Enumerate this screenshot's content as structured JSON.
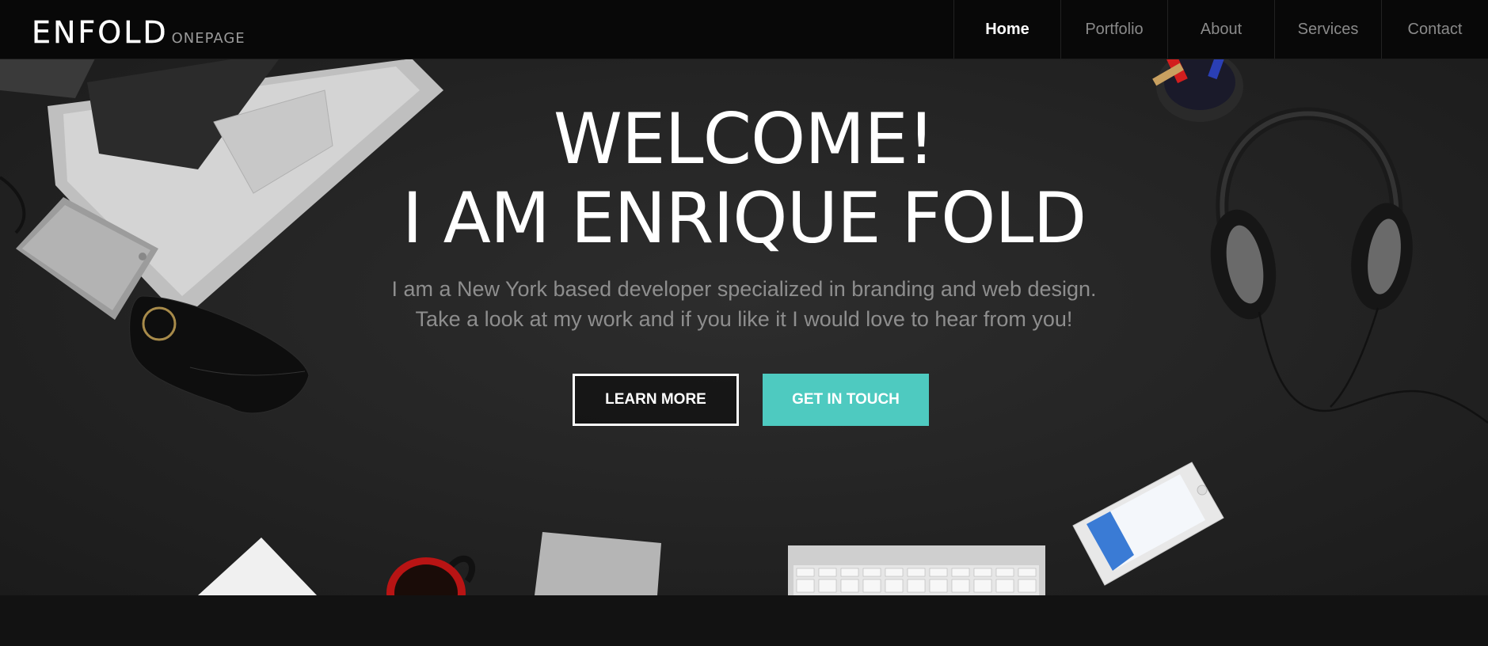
{
  "header": {
    "logo_main": "ENFOLD",
    "logo_sub": "ONEPAGE",
    "nav": [
      {
        "label": "Home",
        "active": true
      },
      {
        "label": "Portfolio",
        "active": false
      },
      {
        "label": "About",
        "active": false
      },
      {
        "label": "Services",
        "active": false
      },
      {
        "label": "Contact",
        "active": false
      }
    ]
  },
  "hero": {
    "title_line1": "WELCOME!",
    "title_line2": "I AM ENRIQUE FOLD",
    "subtitle_line1": "I am a New York based developer specialized in branding and web design.",
    "subtitle_line2": "Take a look at my work and if you like it I would love to hear from you!",
    "learn_more": "LEARN MORE",
    "get_in_touch": "GET IN TOUCH"
  },
  "colors": {
    "accent": "#4ecac0",
    "header_bg": "#080808",
    "hero_bg": "#262626"
  },
  "icons": [
    "laptop",
    "hard-drive",
    "glasses-case",
    "headphones",
    "pen-cup",
    "notepad",
    "coffee-mug",
    "trackpad",
    "keyboard",
    "smartphone"
  ]
}
